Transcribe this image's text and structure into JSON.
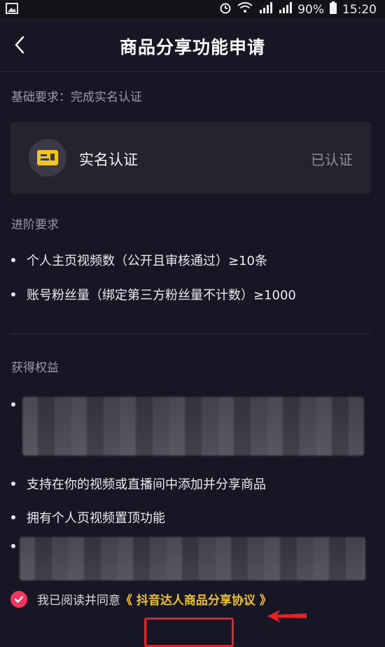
{
  "status_bar": {
    "battery": "90%",
    "time": "15:20"
  },
  "header": {
    "title": "商品分享功能申请"
  },
  "basic": {
    "label": "基础要求：完成实名认证",
    "card": {
      "name": "实名认证",
      "status": "已认证"
    }
  },
  "advanced": {
    "label": "进阶要求",
    "items": [
      "个人主页视频数（公开且审核通过）≥10条",
      "账号粉丝量（绑定第三方粉丝量不计数）≥1000"
    ]
  },
  "benefits": {
    "label": "获得权益",
    "items": [
      "支持在你的视频或直播间中添加并分享商品",
      "拥有个人页视频置顶功能"
    ]
  },
  "agreement": {
    "prefix": "我已阅读并同意",
    "link": "《 抖音达人商品分享协议 》",
    "checked": true
  },
  "colors": {
    "background": "#161624",
    "card": "#24242f",
    "accent_pink": "#f0355f",
    "link_yellow": "#f2c21c",
    "annotation_red": "#e8202a"
  }
}
